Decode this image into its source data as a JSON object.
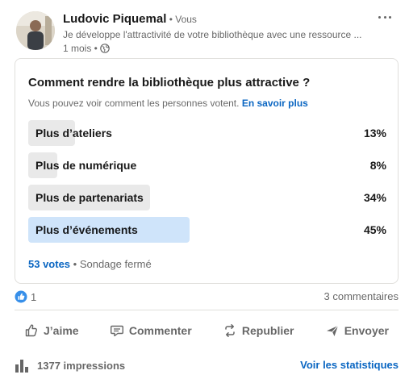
{
  "post": {
    "author_name": "Ludovic Piquemal",
    "author_relation": " • Vous",
    "headline": "Je développe l'attractivité de votre bibliothèque avec une ressource ...",
    "time": "1 mois •"
  },
  "poll": {
    "question": "Comment rendre la bibliothèque plus attractive ?",
    "note": "Vous pouvez voir comment les personnes votent.",
    "learn_more": "En savoir plus",
    "options": [
      {
        "label": "Plus d’ateliers",
        "percent": 13,
        "percent_label": "13%",
        "selected": false
      },
      {
        "label": "Plus de numérique",
        "percent": 8,
        "percent_label": "8%",
        "selected": false
      },
      {
        "label": "Plus de partenariats",
        "percent": 34,
        "percent_label": "34%",
        "selected": false
      },
      {
        "label": "Plus d’événements",
        "percent": 45,
        "percent_label": "45%",
        "selected": true
      }
    ],
    "votes": "53 votes",
    "status": " • Sondage fermé"
  },
  "social": {
    "reactions": "1",
    "comments": "3 commentaires"
  },
  "actions": {
    "like": "J’aime",
    "comment": "Commenter",
    "repost": "Republier",
    "send": "Envoyer"
  },
  "footer": {
    "impressions": "1377 impressions",
    "stats": "Voir les statistiques"
  },
  "colors": {
    "link": "#0a66c2",
    "bar": "#e9e9e9",
    "bar_selected": "#cfe4fa"
  }
}
